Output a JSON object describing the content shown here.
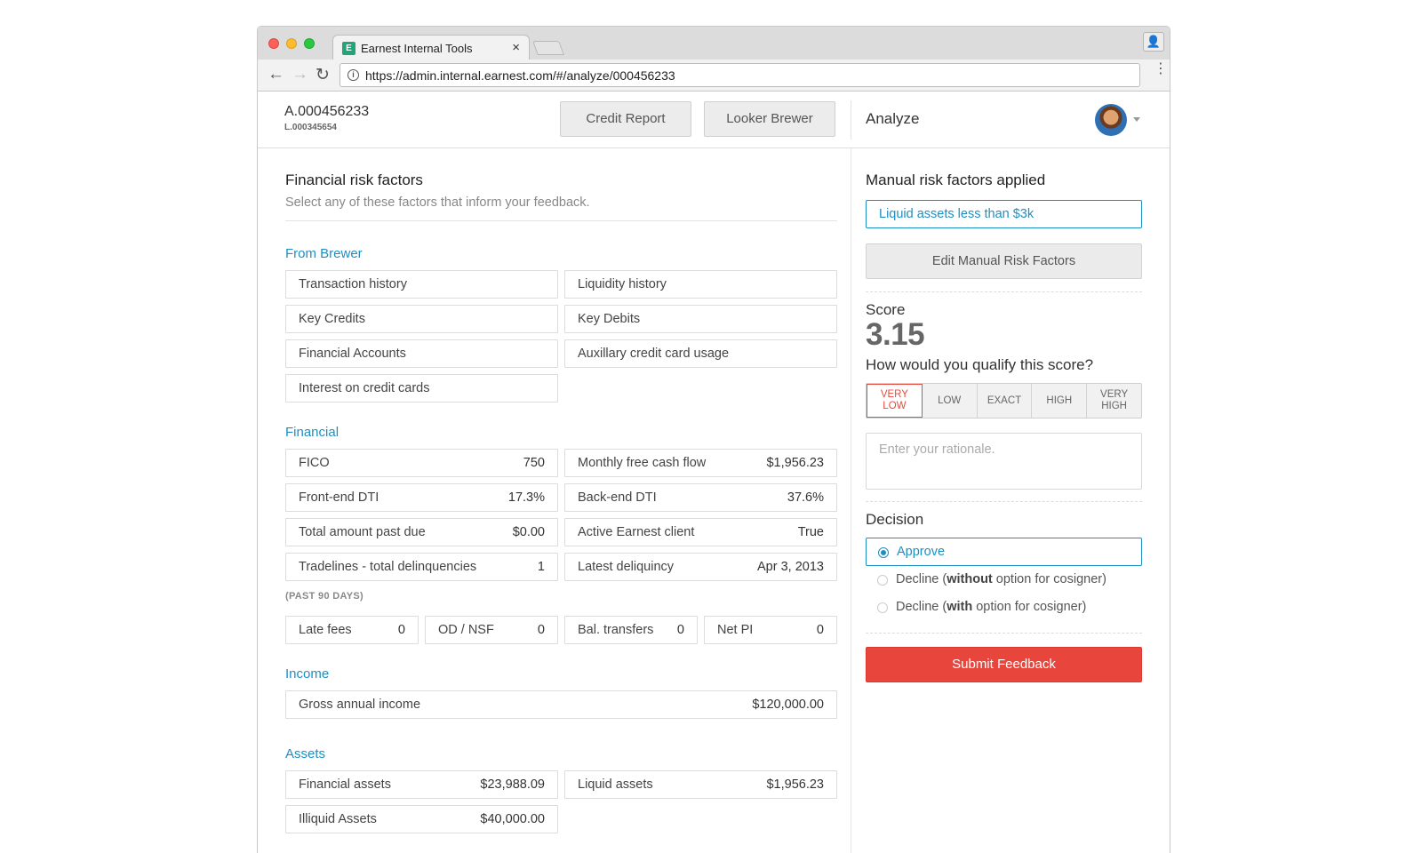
{
  "browser": {
    "tab_title": "Earnest Internal Tools",
    "tab_close": "×",
    "favicon_glyph": "E",
    "url": "https://admin.internal.earnest.com/#/analyze/000456233",
    "icons": {
      "back": "←",
      "forward": "→",
      "reload": "↻",
      "info": "i",
      "menu": "⋮",
      "profile": "👤"
    }
  },
  "header": {
    "application_id": "A.000456233",
    "loan_id": "L.000345654",
    "credit_report_label": "Credit Report",
    "looker_brewer_label": "Looker Brewer",
    "section_title": "Analyze"
  },
  "risk_factors": {
    "title": "Financial risk factors",
    "subtitle": "Select any of these factors that inform your feedback.",
    "from_brewer": {
      "label": "From Brewer",
      "items": [
        "Transaction history",
        "Liquidity history",
        "Key Credits",
        "Key Debits",
        "Financial Accounts",
        "Auxillary credit card usage",
        "Interest on credit cards"
      ]
    },
    "financial": {
      "label": "Financial",
      "rows": [
        {
          "label": "FICO",
          "value": "750"
        },
        {
          "label": "Monthly free cash flow",
          "value": "$1,956.23"
        },
        {
          "label": "Front-end DTI",
          "value": "17.3%"
        },
        {
          "label": "Back-end DTI",
          "value": "37.6%"
        },
        {
          "label": "Total amount past due",
          "value": "$0.00"
        },
        {
          "label": "Active Earnest client",
          "value": "True"
        },
        {
          "label": "Tradelines - total delinquencies",
          "value": "1"
        },
        {
          "label": "Latest deliquincy",
          "value": "Apr 3, 2013"
        }
      ],
      "past_label": "(PAST 90 DAYS)",
      "past_rows": [
        {
          "label": "Late fees",
          "value": "0"
        },
        {
          "label": "OD / NSF",
          "value": "0"
        },
        {
          "label": "Bal. transfers",
          "value": "0"
        },
        {
          "label": "Net PI",
          "value": "0"
        }
      ]
    },
    "income": {
      "label": "Income",
      "rows": [
        {
          "label": "Gross annual income",
          "value": "$120,000.00"
        }
      ]
    },
    "assets": {
      "label": "Assets",
      "rows": [
        {
          "label": "Financial assets",
          "value": "$23,988.09"
        },
        {
          "label": "Liquid assets",
          "value": "$1,956.23"
        },
        {
          "label": "Illiquid Assets",
          "value": "$40,000.00"
        }
      ]
    }
  },
  "analyze": {
    "manual_title": "Manual risk factors applied",
    "applied": [
      "Liquid assets less than $3k"
    ],
    "edit_label": "Edit Manual Risk Factors",
    "score_label": "Score",
    "score_value": "3.15",
    "qualify_question": "How would you qualify this score?",
    "qualify_options": [
      "VERY LOW",
      "LOW",
      "EXACT",
      "HIGH",
      "VERY HIGH"
    ],
    "qualify_selected": "VERY LOW",
    "rationale_placeholder": "Enter your rationale.",
    "decision_title": "Decision",
    "decision_options": {
      "approve": "Approve",
      "decline_without_prefix": "Decline (",
      "decline_without_bold": "without",
      "decline_without_suffix": " option for cosigner)",
      "decline_with_prefix": "Decline (",
      "decline_with_bold": "with",
      "decline_with_suffix": " option for cosigner)"
    },
    "decision_selected": "Approve",
    "submit_label": "Submit Feedback"
  },
  "colors": {
    "accent": "#1f8fc2",
    "danger": "#e8453c",
    "selected_qualifier": "#e74c3c"
  }
}
